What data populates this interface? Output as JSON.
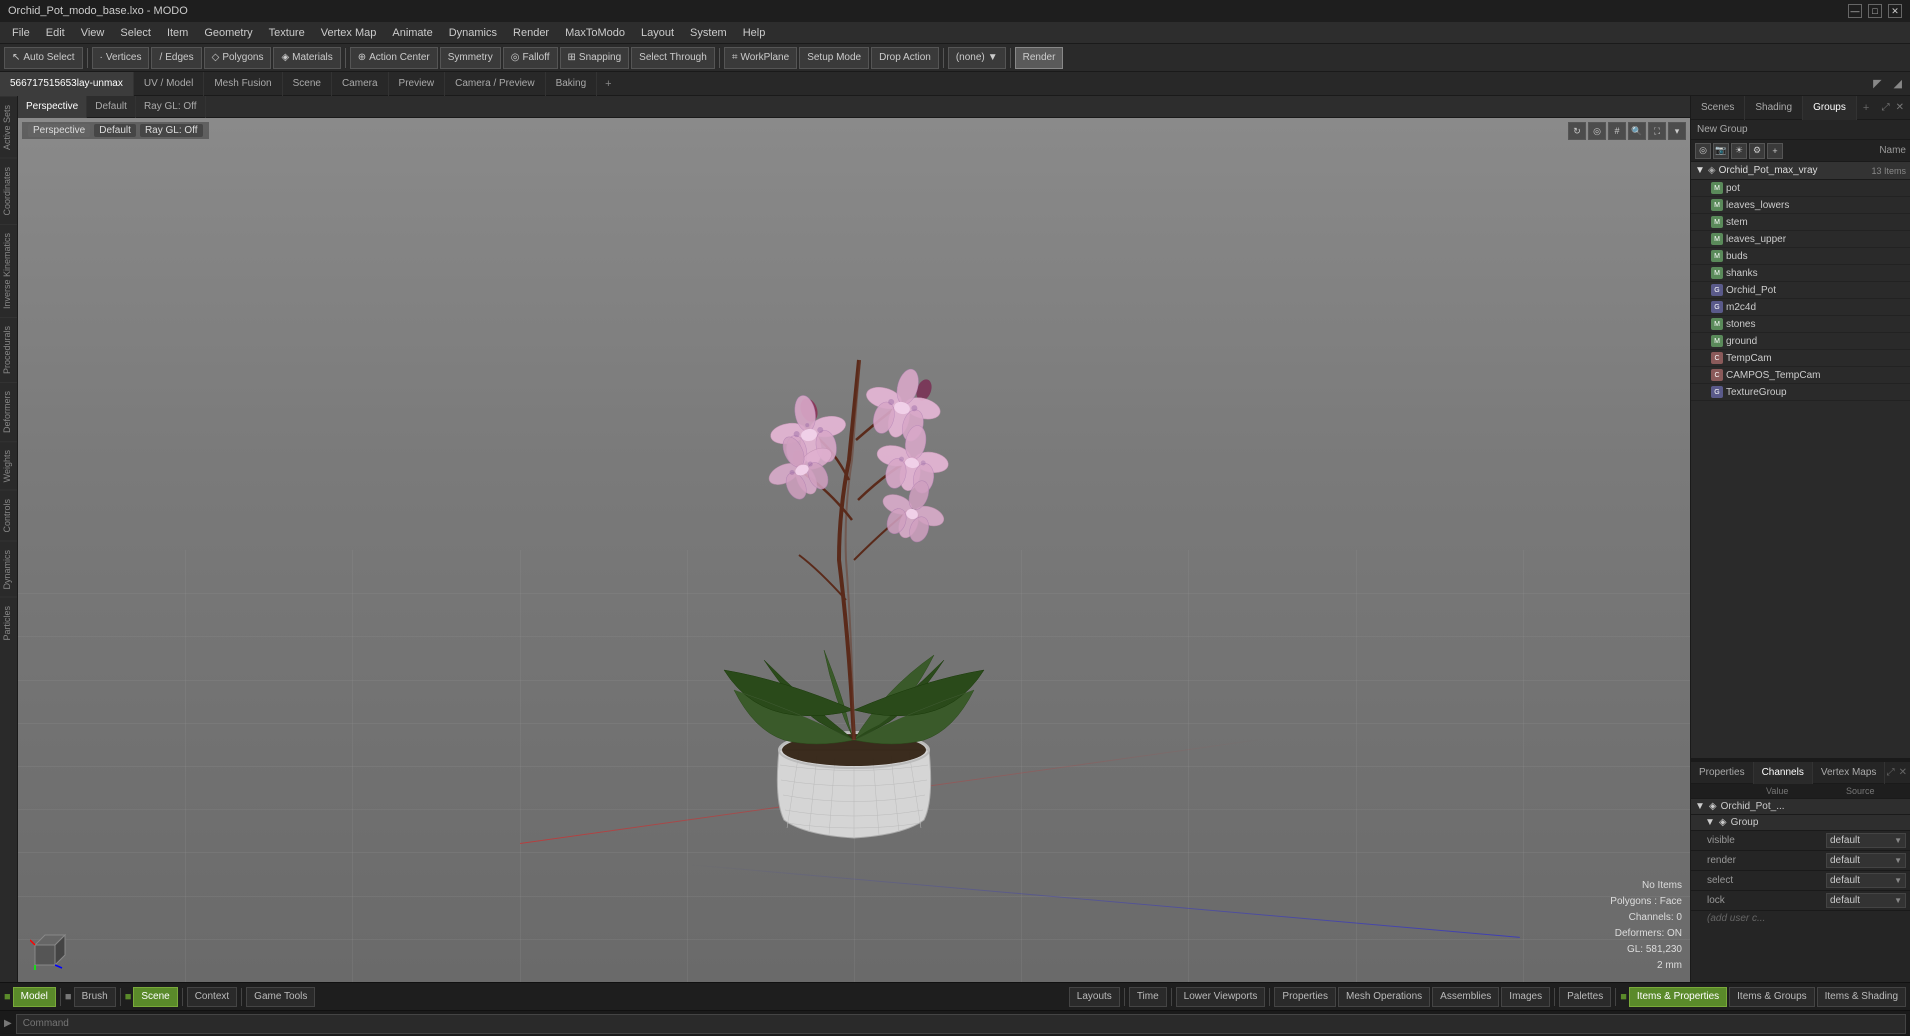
{
  "titlebar": {
    "title": "Orchid_Pot_modo_base.lxo - MODO",
    "min": "—",
    "max": "□",
    "close": "✕"
  },
  "menubar": {
    "items": [
      "File",
      "Edit",
      "View",
      "Select",
      "Item",
      "Geometry",
      "Texture",
      "Vertex Map",
      "Animate",
      "Dynamics",
      "Render",
      "MaxToModo",
      "Layout",
      "System",
      "Help"
    ]
  },
  "toolbar": {
    "auto_select": "Auto Select",
    "vertices": "Vertices",
    "edges": "Edges",
    "polygons": "Polygons",
    "materials": "Materials",
    "action_center": "Action Center",
    "symmetry": "Symmetry",
    "falloff": "Falloff",
    "snapping": "Snapping",
    "select_through": "Select Through",
    "workplane": "WorkPlane",
    "setup_mode": "Setup Mode",
    "drop_action": "Drop Action",
    "none_dropdown": "(none)",
    "render": "Render"
  },
  "viewport_tabs": {
    "tabs": [
      {
        "label": "566717515653lay-unmax",
        "active": true
      },
      {
        "label": "UV / Model",
        "active": false
      },
      {
        "label": "Mesh Fusion",
        "active": false
      },
      {
        "label": "Scene",
        "active": false
      },
      {
        "label": "Camera",
        "active": false
      },
      {
        "label": "Preview",
        "active": false
      },
      {
        "label": "Camera / Preview",
        "active": false
      },
      {
        "label": "Baking",
        "active": false
      }
    ],
    "add": "+"
  },
  "viewport_sub_tabs": {
    "view_label": "Perspective",
    "shader_label": "Default",
    "ray_label": "Ray GL: Off"
  },
  "scene_panel": {
    "right_tabs": [
      "Scenes",
      "Shading",
      "Groups"
    ],
    "active_tab": "Groups",
    "new_group_label": "New Group",
    "tree_header_cols": [
      "Name"
    ],
    "root_item": "Orchid_Pot_max_vray",
    "root_item_count": "13 Items",
    "items": [
      {
        "name": "pot",
        "type": "mesh",
        "selected": false
      },
      {
        "name": "leaves_lowers",
        "type": "mesh",
        "selected": false
      },
      {
        "name": "stem",
        "type": "mesh",
        "selected": false
      },
      {
        "name": "leaves_upper",
        "type": "mesh",
        "selected": false
      },
      {
        "name": "buds",
        "type": "mesh",
        "selected": false
      },
      {
        "name": "shanks",
        "type": "mesh",
        "selected": false
      },
      {
        "name": "Orchid_Pot",
        "type": "group",
        "selected": false
      },
      {
        "name": "m2c4d",
        "type": "group",
        "selected": false
      },
      {
        "name": "stones",
        "type": "mesh",
        "selected": false
      },
      {
        "name": "ground",
        "type": "mesh",
        "selected": false
      },
      {
        "name": "TempCam",
        "type": "cam",
        "selected": false
      },
      {
        "name": "CAMPOS_TempCam",
        "type": "cam",
        "selected": false
      },
      {
        "name": "TextureGroup",
        "type": "group",
        "selected": false
      }
    ]
  },
  "properties_panel": {
    "tabs": [
      "Properties",
      "Channels",
      "Vertex Maps"
    ],
    "active_tab": "Channels",
    "header": {
      "col1": "",
      "col2": "Value",
      "col3": "Source"
    },
    "root_name": "Orchid_Pot_...",
    "group_name": "Group",
    "rows": [
      {
        "name": "visible",
        "value": "default"
      },
      {
        "name": "render",
        "value": "default"
      },
      {
        "name": "select",
        "value": "default"
      },
      {
        "name": "lock",
        "value": "default"
      }
    ],
    "add_row": "(add user c..."
  },
  "viewport_info": {
    "no_items": "No Items",
    "polygons": "Polygons : Face",
    "channels": "Channels: 0",
    "deformers": "Deformers: ON",
    "gl_info": "GL: 581,230",
    "unit": "2 mm"
  },
  "bottom_toolbar": {
    "buttons": [
      {
        "label": "Model",
        "active": true,
        "dot_color": "#5a8a2a"
      },
      {
        "label": "Brush",
        "active": false,
        "dot_color": "#777"
      },
      {
        "label": "Scene",
        "active": true,
        "dot_color": "#5a8a2a"
      },
      {
        "label": "Context",
        "active": false,
        "dot_color": "#777"
      },
      {
        "label": "Game Tools",
        "active": false,
        "dot_color": "#777"
      },
      {
        "sep": true
      },
      {
        "label": "Layouts",
        "active": false,
        "dot_color": "#777"
      },
      {
        "sep": true
      },
      {
        "label": "Time",
        "active": false,
        "dot_color": "#777"
      },
      {
        "sep": true
      },
      {
        "label": "Lower Viewports",
        "active": false,
        "dot_color": "#777"
      },
      {
        "sep": true
      },
      {
        "label": "Properties",
        "active": false,
        "dot_color": "#777"
      },
      {
        "label": "Mesh Operations",
        "active": false,
        "dot_color": "#777"
      },
      {
        "label": "Assemblies",
        "active": false,
        "dot_color": "#777"
      },
      {
        "label": "Images",
        "active": false,
        "dot_color": "#777"
      },
      {
        "sep": true
      },
      {
        "label": "Palettes",
        "active": false,
        "dot_color": "#777"
      },
      {
        "sep": true
      },
      {
        "label": "Items & Properties",
        "active": true,
        "dot_color": "#5a8a2a"
      },
      {
        "label": "Items & Groups",
        "active": false,
        "dot_color": "#777"
      },
      {
        "label": "Items & Shading",
        "active": false,
        "dot_color": "#777"
      }
    ]
  },
  "command_bar": {
    "label": "Command",
    "placeholder": "Command"
  }
}
